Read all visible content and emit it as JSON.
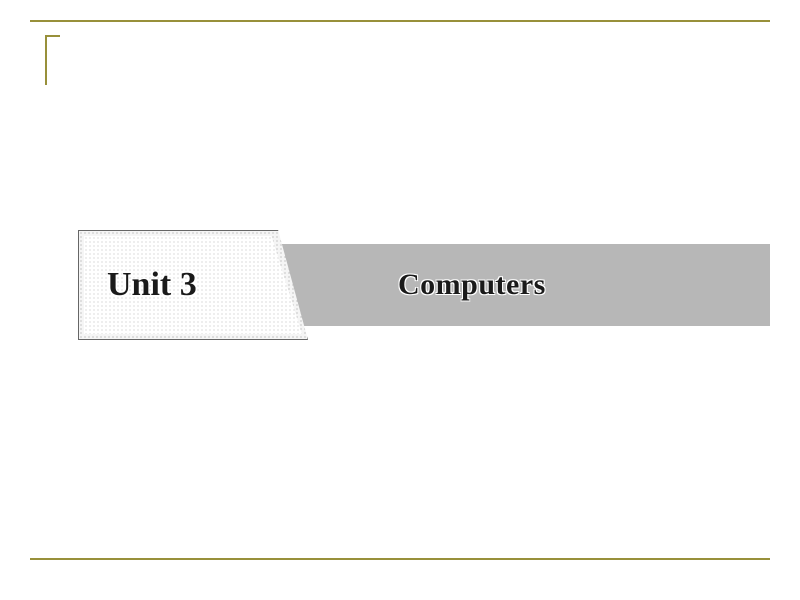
{
  "slide": {
    "unit_label": "Unit 3",
    "topic_label": "Computers",
    "accent_color": "#98903a"
  }
}
